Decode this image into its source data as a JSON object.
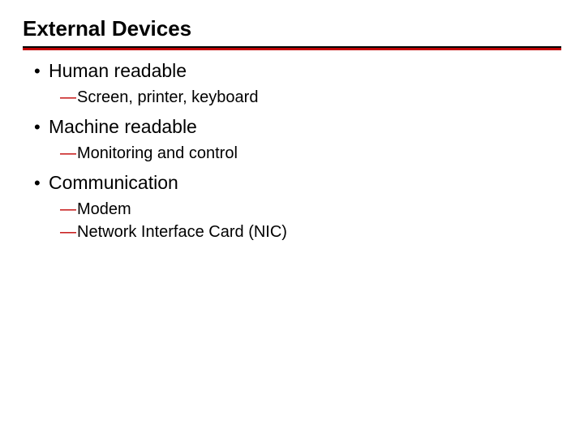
{
  "slide": {
    "title": "External Devices",
    "bullets": [
      {
        "label": "Human readable",
        "subs": [
          {
            "label": "Screen, printer, keyboard"
          }
        ]
      },
      {
        "label": "Machine readable",
        "subs": [
          {
            "label": "Monitoring and control"
          }
        ]
      },
      {
        "label": "Communication",
        "subs": [
          {
            "label": "Modem"
          },
          {
            "label": "Network Interface Card (NIC)"
          }
        ]
      }
    ]
  },
  "glyphs": {
    "bullet": "•",
    "dash": "—"
  }
}
